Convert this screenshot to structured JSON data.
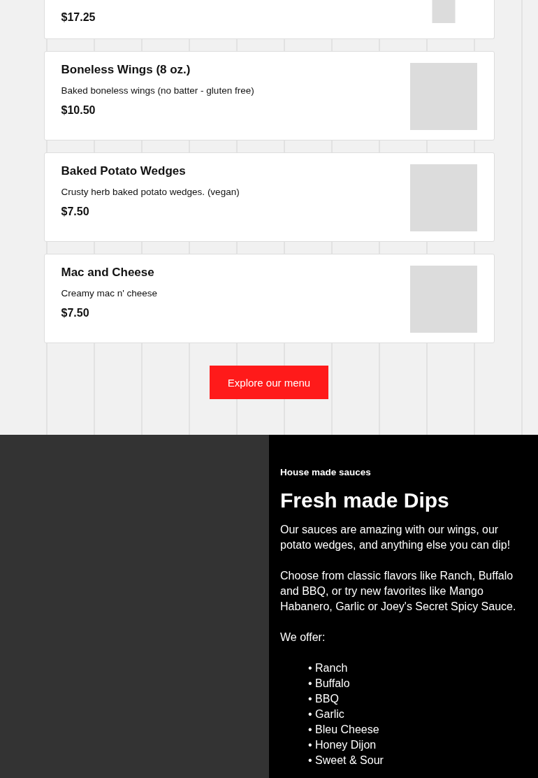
{
  "menu_items": [
    {
      "price": "$17.25",
      "partial": true
    },
    {
      "name": "Boneless Wings (8 oz.)",
      "description": "Baked boneless wings (no batter - gluten free)",
      "price": "$10.50",
      "partial": false
    },
    {
      "name": "Baked Potato Wedges",
      "description": "Crusty herb baked potato wedges. (vegan)",
      "price": "$7.50",
      "partial": false
    },
    {
      "name": "Mac and Cheese",
      "description": "Creamy mac n' cheese",
      "price": "$7.50",
      "partial": false
    }
  ],
  "explore_button": "Explore our menu",
  "sauces": {
    "eyebrow": "House made sauces",
    "heading": "Fresh made Dips",
    "paragraphs": [
      "Our sauces are amazing with our wings, our potato wedges, and anything else you can dip!",
      "Choose from classic flavors like Ranch, Buffalo and BBQ, or try new favorites like Mango Habanero, Garlic or Joey's Secret Spicy Sauce.",
      "We offer:"
    ],
    "list": [
      "• Ranch",
      "• Buffalo",
      "• BBQ",
      "• Garlic",
      "• Bleu Cheese",
      "• Honey Dijon",
      "• Sweet & Sour"
    ]
  }
}
